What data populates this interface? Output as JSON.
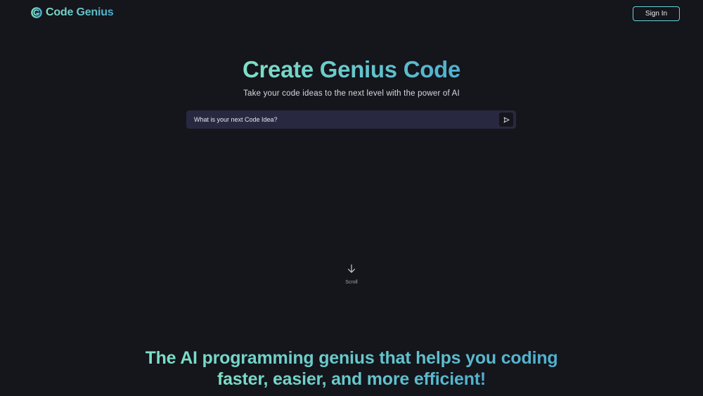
{
  "header": {
    "brand": "Code Genius",
    "logo_icon": "code-genius-logo-icon",
    "sign_in_label": "Sign In"
  },
  "hero": {
    "title": "Create Genius Code",
    "subtitle": "Take your code ideas to the next level with the power of AI",
    "prompt": {
      "placeholder": "What is your next Code Idea?",
      "value": "",
      "send_icon": "send-icon"
    }
  },
  "scroll": {
    "icon": "arrow-down-icon",
    "label": "Scroll"
  },
  "tagline": {
    "line1": "The AI programming genius that helps you coding",
    "line2": "faster, easier, and more efficient!"
  },
  "colors": {
    "background": "#15151c",
    "accent_start": "#7ee0c6",
    "accent_end": "#4fb0cf",
    "input_bg": "#282940",
    "button_border": "#66d2d8"
  }
}
